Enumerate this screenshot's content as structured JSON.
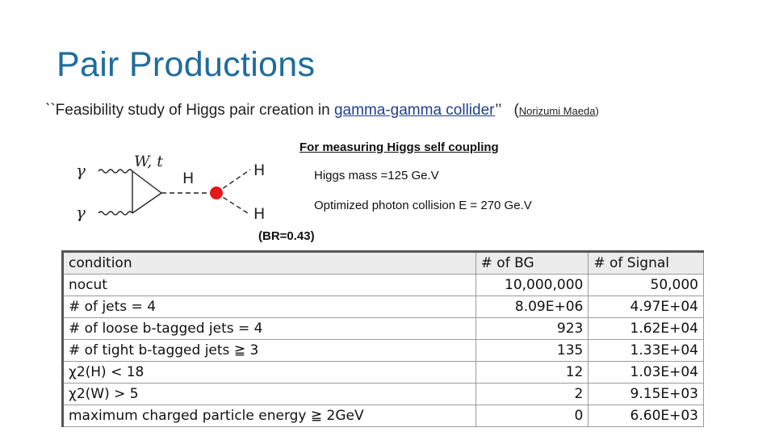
{
  "slide": {
    "title": "Pair Productions",
    "subtitle_prefix": "``Feasibility study of Higgs pair creation in ",
    "subtitle_link": "gamma-gamma collider",
    "subtitle_suffix": "’’",
    "paren_open": "(",
    "author": "Norizumi Maeda",
    "paren_close": ")",
    "note_purpose": "For measuring Higgs self coupling",
    "note_mass": "Higgs mass =125 Ge.V",
    "note_energy": "Optimized photon collision E = 270 Ge.V",
    "note_br": "(BR=0.43)"
  },
  "diagram": {
    "photon1": "γ",
    "photon2": "γ",
    "loop_label": "W, t",
    "propagator": "H",
    "out1": "H",
    "out2": "H",
    "vertex_color": "#e8151b"
  },
  "table": {
    "headers": [
      "condition",
      "# of BG",
      "# of Signal"
    ],
    "rows": [
      {
        "condition": "nocut",
        "bg": "10,000,000",
        "signal": "50,000"
      },
      {
        "condition": "# of jets = 4",
        "bg": "8.09E+06",
        "signal": "4.97E+04"
      },
      {
        "condition": "# of loose b-tagged jets = 4",
        "bg": "923",
        "signal": "1.62E+04"
      },
      {
        "condition": "# of tight b-tagged jets ≧ 3",
        "bg": "135",
        "signal": "1.33E+04"
      },
      {
        "condition": "χ2(H) < 18",
        "bg": "12",
        "signal": "1.03E+04"
      },
      {
        "condition": "χ2(W) > 5",
        "bg": "2",
        "signal": "9.15E+03"
      },
      {
        "condition": "maximum charged particle energy ≧ 2GeV",
        "bg": "0",
        "signal": "6.60E+03"
      }
    ]
  },
  "colors": {
    "title": "#1f6c9c",
    "link": "#1f3f8f"
  }
}
